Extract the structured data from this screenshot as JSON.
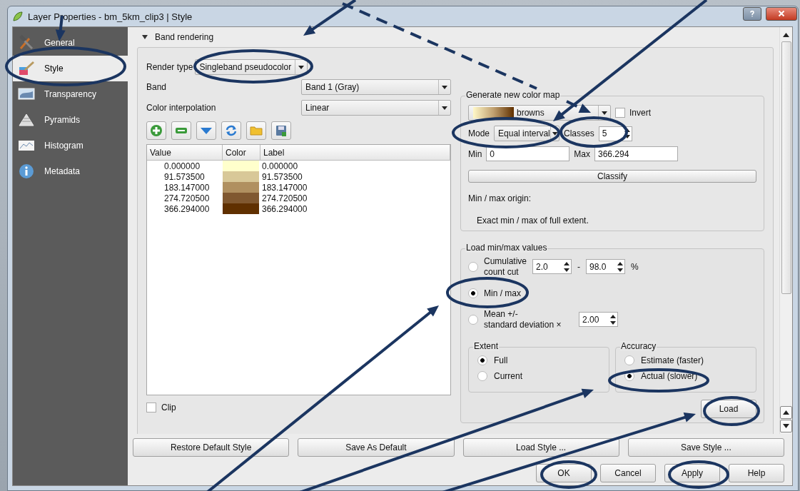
{
  "window": {
    "title": "Layer Properties - bm_5km_clip3 | Style"
  },
  "sidebar": {
    "items": [
      {
        "label": "General",
        "selected": false
      },
      {
        "label": "Style",
        "selected": true
      },
      {
        "label": "Transparency",
        "selected": false
      },
      {
        "label": "Pyramids",
        "selected": false
      },
      {
        "label": "Histogram",
        "selected": false
      },
      {
        "label": "Metadata",
        "selected": false
      }
    ]
  },
  "band_rendering": {
    "title": "Band rendering",
    "expanded": true,
    "render_type": {
      "label": "Render type",
      "value": "Singleband pseudocolor"
    },
    "band": {
      "label": "Band",
      "value": "Band 1 (Gray)"
    },
    "color_interpolation": {
      "label": "Color interpolation",
      "value": "Linear"
    },
    "table": {
      "columns": [
        "Value",
        "Color",
        "Label"
      ],
      "rows": [
        {
          "value": "0.000000",
          "color": "#ffffcc",
          "label": "0.000000"
        },
        {
          "value": "91.573500",
          "color": "#d8c898",
          "label": "91.573500"
        },
        {
          "value": "183.147000",
          "color": "#b09060",
          "label": "183.147000"
        },
        {
          "value": "274.720500",
          "color": "#805830",
          "label": "274.720500"
        },
        {
          "value": "366.294000",
          "color": "#603000",
          "label": "366.294000"
        }
      ]
    },
    "clip": {
      "label": "Clip",
      "checked": false
    }
  },
  "color_map": {
    "title": "Generate new color map",
    "ramp": "browns",
    "invert": {
      "label": "Invert",
      "checked": false
    },
    "mode": {
      "label": "Mode",
      "value": "Equal interval"
    },
    "classes": {
      "label": "Classes",
      "value": "5"
    },
    "min": {
      "label": "Min",
      "value": "0"
    },
    "max": {
      "label": "Max",
      "value": "366.294"
    },
    "classify": "Classify",
    "origin_label": "Min / max origin:",
    "origin_text": "Exact min / max of full extent."
  },
  "load_minmax": {
    "title": "Load min/max values",
    "options": [
      {
        "kind": "range",
        "label": "Cumulative count cut",
        "selected": false,
        "from": "2.0",
        "separator": "-",
        "to": "98.0",
        "unit": "%"
      },
      {
        "kind": "plain",
        "label": "Min / max",
        "selected": true
      },
      {
        "kind": "factor",
        "label": "Mean +/-\nstandard deviation ×",
        "selected": false,
        "factor": "2.00"
      }
    ],
    "extent": {
      "title": "Extent",
      "options": [
        {
          "label": "Full",
          "selected": true
        },
        {
          "label": "Current",
          "selected": false
        }
      ]
    },
    "accuracy": {
      "title": "Accuracy",
      "options": [
        {
          "label": "Estimate (faster)",
          "selected": false
        },
        {
          "label": "Actual (slower)",
          "selected": true
        }
      ]
    },
    "load": "Load"
  },
  "style_buttons": [
    "Restore Default Style",
    "Save As Default",
    "Load Style ...",
    "Save Style ..."
  ],
  "dialog_buttons": [
    "OK",
    "Cancel",
    "Apply",
    "Help"
  ]
}
